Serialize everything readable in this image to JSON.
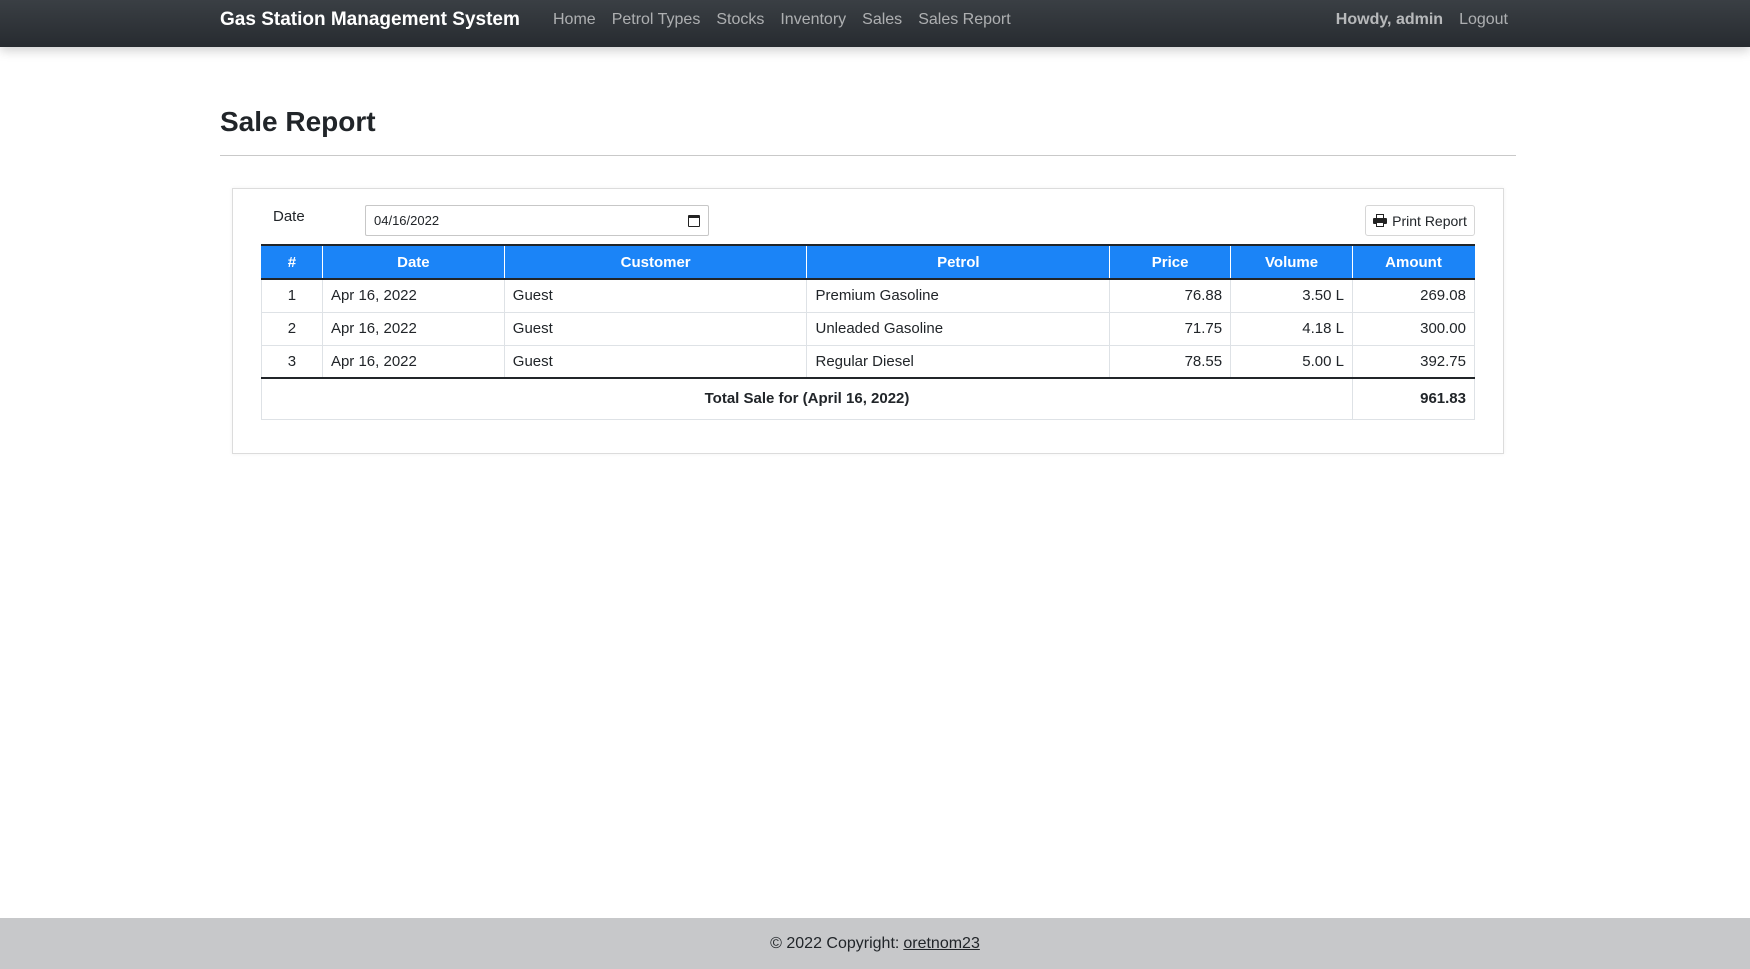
{
  "navbar": {
    "brand": "Gas Station Management System",
    "links": [
      "Home",
      "Petrol Types",
      "Stocks",
      "Inventory",
      "Sales",
      "Sales Report"
    ],
    "greeting": "Howdy, admin",
    "logout": "Logout"
  },
  "page": {
    "title": "Sale Report"
  },
  "filter": {
    "date_label": "Date",
    "date_value": "04/16/2022",
    "print_label": "Print Report"
  },
  "table": {
    "headers": [
      "#",
      "Date",
      "Customer",
      "Petrol",
      "Price",
      "Volume",
      "Amount"
    ],
    "rows": [
      [
        "1",
        "Apr 16, 2022",
        "Guest",
        "Premium Gasoline",
        "76.88",
        "3.50 L",
        "269.08"
      ],
      [
        "2",
        "Apr 16, 2022",
        "Guest",
        "Unleaded Gasoline",
        "71.75",
        "4.18 L",
        "300.00"
      ],
      [
        "3",
        "Apr 16, 2022",
        "Guest",
        "Regular Diesel",
        "78.55",
        "5.00 L",
        "392.75"
      ]
    ],
    "total_label": "Total Sale for (April 16, 2022)",
    "total_value": "961.83"
  },
  "footer": {
    "copyright": "© 2022 Copyright:",
    "author": "oretnom23"
  }
}
